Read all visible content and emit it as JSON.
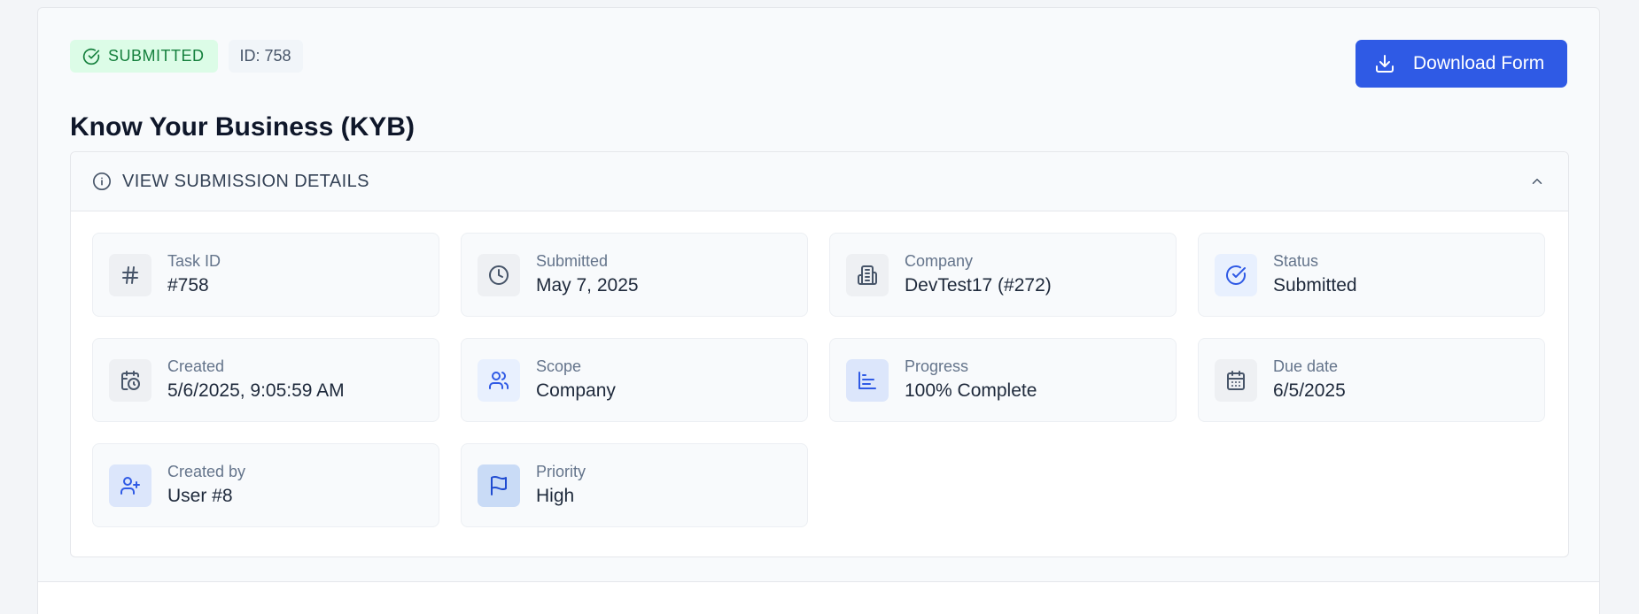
{
  "badges": {
    "status": "SUBMITTED",
    "id": "ID: 758"
  },
  "actions": {
    "download_label": "Download Form"
  },
  "page": {
    "title": "Know Your Business (KYB)"
  },
  "details": {
    "header": "VIEW SUBMISSION DETAILS",
    "items": [
      {
        "label": "Task ID",
        "value": "#758",
        "icon": "hash-icon"
      },
      {
        "label": "Submitted",
        "value": "May 7, 2025",
        "icon": "clock-icon"
      },
      {
        "label": "Company",
        "value": "DevTest17 (#272)",
        "icon": "building-icon"
      },
      {
        "label": "Status",
        "value": "Submitted",
        "icon": "check-badge-icon"
      },
      {
        "label": "Created",
        "value": "5/6/2025, 9:05:59 AM",
        "icon": "calendar-clock-icon"
      },
      {
        "label": "Scope",
        "value": "Company",
        "icon": "users-icon"
      },
      {
        "label": "Progress",
        "value": "100% Complete",
        "icon": "bar-chart-icon"
      },
      {
        "label": "Due date",
        "value": "6/5/2025",
        "icon": "calendar-icon"
      },
      {
        "label": "Created by",
        "value": "User #8",
        "icon": "user-plus-icon"
      },
      {
        "label": "Priority",
        "value": "High",
        "icon": "flag-icon"
      }
    ]
  },
  "colors": {
    "primary": "#2f5ae5",
    "success_bg": "#dcfce7",
    "success_text": "#15803d"
  }
}
